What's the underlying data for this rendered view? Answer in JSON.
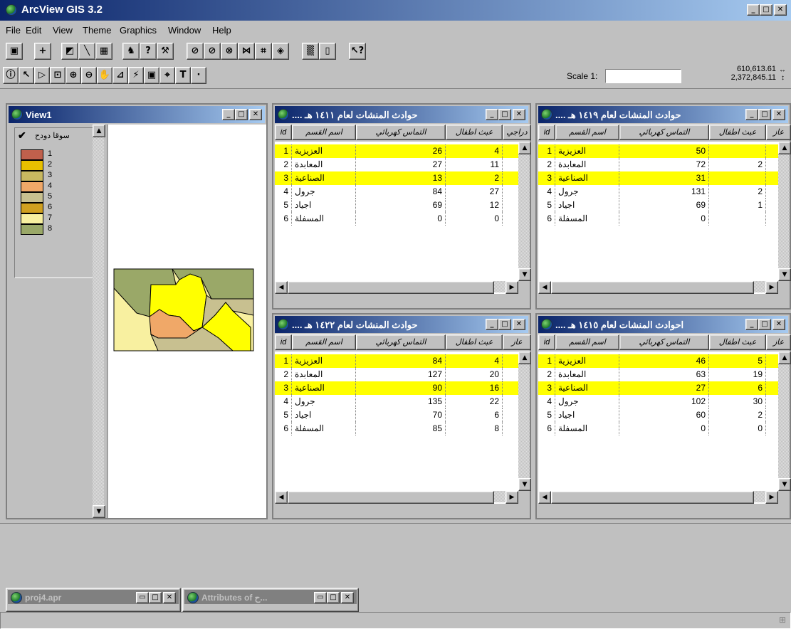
{
  "app": {
    "title": "ArcView GIS 3.2"
  },
  "menu": [
    "File",
    "Edit",
    "View",
    "Theme",
    "Graphics",
    "Window",
    "Help"
  ],
  "scale": {
    "label": "Scale 1:",
    "value": "",
    "x_coord": "610,613.61",
    "y_coord": "2,372,845.11"
  },
  "view1": {
    "title": "View1",
    "theme_name": "سوقا دودح",
    "legend": [
      {
        "label": "1",
        "color": "#c0604c"
      },
      {
        "label": "2",
        "color": "#e8c000"
      },
      {
        "label": "3",
        "color": "#c8b860"
      },
      {
        "label": "4",
        "color": "#f0a868"
      },
      {
        "label": "5",
        "color": "#c8c090"
      },
      {
        "label": "6",
        "color": "#d0a020"
      },
      {
        "label": "7",
        "color": "#f8f0a0"
      },
      {
        "label": "8",
        "color": "#9aa868"
      }
    ]
  },
  "columns": {
    "id": "id",
    "name": "اسم القسم",
    "electric": "التماس كهربائي",
    "kids": "عبث اطفال",
    "other": "دراجي",
    "other2": "عاز"
  },
  "tables": [
    {
      "title": "حوادث المنشات لعام ١٤١١ هـ ....",
      "rows": [
        {
          "id": "1",
          "name": "العزيزية",
          "electric": "26",
          "kids": "4",
          "sel": true
        },
        {
          "id": "2",
          "name": "المعابدة",
          "electric": "27",
          "kids": "11",
          "sel": false
        },
        {
          "id": "3",
          "name": "الصناعية",
          "electric": "13",
          "kids": "2",
          "sel": true
        },
        {
          "id": "4",
          "name": "جرول",
          "electric": "84",
          "kids": "27",
          "sel": false
        },
        {
          "id": "5",
          "name": "اجياد",
          "electric": "69",
          "kids": "12",
          "sel": false
        },
        {
          "id": "6",
          "name": "المسفلة",
          "electric": "0",
          "kids": "0",
          "sel": false
        }
      ]
    },
    {
      "title": "حوادث المنشات لعام ١٤١٩ هـ ....",
      "rows": [
        {
          "id": "1",
          "name": "العزيزية",
          "electric": "50",
          "kids": "",
          "sel": true
        },
        {
          "id": "2",
          "name": "المعابدة",
          "electric": "72",
          "kids": "2",
          "sel": false
        },
        {
          "id": "3",
          "name": "الصناعية",
          "electric": "31",
          "kids": "",
          "sel": true
        },
        {
          "id": "4",
          "name": "جرول",
          "electric": "131",
          "kids": "2",
          "sel": false
        },
        {
          "id": "5",
          "name": "اجياد",
          "electric": "69",
          "kids": "1",
          "sel": false
        },
        {
          "id": "6",
          "name": "المسفلة",
          "electric": "0",
          "kids": "",
          "sel": false
        }
      ]
    },
    {
      "title": "حوادث المنشات لعام ١٤٢٢ هـ ....",
      "rows": [
        {
          "id": "1",
          "name": "العزيزية",
          "electric": "84",
          "kids": "4",
          "sel": true
        },
        {
          "id": "2",
          "name": "المعابدة",
          "electric": "127",
          "kids": "20",
          "sel": false
        },
        {
          "id": "3",
          "name": "الصناعية",
          "electric": "90",
          "kids": "16",
          "sel": true
        },
        {
          "id": "4",
          "name": "جرول",
          "electric": "135",
          "kids": "22",
          "sel": false
        },
        {
          "id": "5",
          "name": "اجياد",
          "electric": "70",
          "kids": "6",
          "sel": false
        },
        {
          "id": "6",
          "name": "المسفلة",
          "electric": "85",
          "kids": "8",
          "sel": false
        }
      ]
    },
    {
      "title": "احوادث المنشات لعام ١٤١٥ هـ ....",
      "rows": [
        {
          "id": "1",
          "name": "العزيزية",
          "electric": "46",
          "kids": "5",
          "sel": true
        },
        {
          "id": "2",
          "name": "المعابدة",
          "electric": "63",
          "kids": "19",
          "sel": false
        },
        {
          "id": "3",
          "name": "الصناعية",
          "electric": "27",
          "kids": "6",
          "sel": true
        },
        {
          "id": "4",
          "name": "جرول",
          "electric": "102",
          "kids": "30",
          "sel": false
        },
        {
          "id": "5",
          "name": "اجياد",
          "electric": "60",
          "kids": "2",
          "sel": false
        },
        {
          "id": "6",
          "name": "المسفلة",
          "electric": "0",
          "kids": "0",
          "sel": false
        }
      ]
    }
  ],
  "taskbar": [
    {
      "label": "proj4.apr"
    },
    {
      "label": "Attributes of ح..."
    }
  ]
}
